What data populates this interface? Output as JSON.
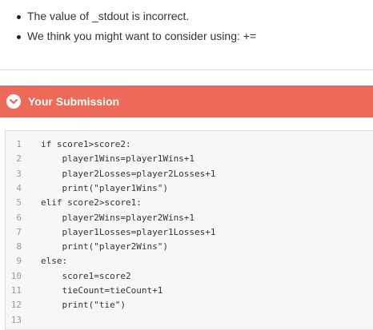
{
  "feedback": {
    "items": [
      "The value of _stdout is incorrect.",
      "We think you might want to consider using: +="
    ]
  },
  "submission": {
    "title": "Your Submission",
    "code_lines": [
      {
        "num": "1",
        "text": "if score1>score2:"
      },
      {
        "num": "2",
        "text": "    player1Wins=player1Wins+1"
      },
      {
        "num": "3",
        "text": "    player2Losses=player2Losses+1"
      },
      {
        "num": "4",
        "text": "    print(\"player1Wins\")"
      },
      {
        "num": "5",
        "text": "elif score2>score1:"
      },
      {
        "num": "6",
        "text": "    player2Wins=player2Wins+1"
      },
      {
        "num": "7",
        "text": "    player1Losses=player1Losses+1"
      },
      {
        "num": "8",
        "text": "    print(\"player2Wins\")"
      },
      {
        "num": "9",
        "text": "else:"
      },
      {
        "num": "10",
        "text": "    score1=score2"
      },
      {
        "num": "11",
        "text": "    tieCount=tieCount+1"
      },
      {
        "num": "12",
        "text": "    print(\"tie\")"
      },
      {
        "num": "13",
        "text": ""
      }
    ]
  },
  "colors": {
    "header_bg": "#ec6a57",
    "code_bg": "#f7f7f7"
  },
  "icons": {
    "header": "chevron-down-circle-icon"
  }
}
